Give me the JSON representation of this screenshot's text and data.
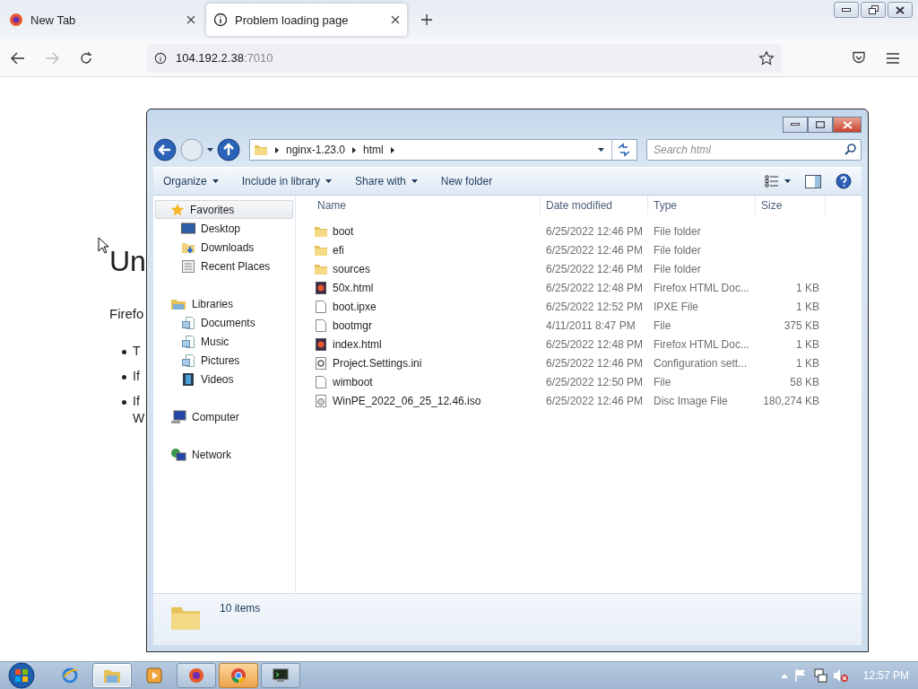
{
  "browser": {
    "tabs": [
      {
        "title": "New Tab",
        "selected": false,
        "kind": "firefox"
      },
      {
        "title": "Problem loading page",
        "selected": true,
        "kind": "info"
      }
    ],
    "address": {
      "host": "104.192.2.38",
      "port": ":7010"
    }
  },
  "page": {
    "heading": "Un",
    "paragraph": "Firefo",
    "bullets": [
      {
        "lines": [
          "T"
        ]
      },
      {
        "lines": [
          "If"
        ]
      },
      {
        "lines": [
          "If",
          "W"
        ]
      }
    ]
  },
  "explorer": {
    "breadcrumb": [
      "nginx-1.23.0",
      "html"
    ],
    "search": {
      "placeholder": "Search html"
    },
    "toolbar": [
      {
        "label": "Organize",
        "dropdown": true
      },
      {
        "label": "Include in library",
        "dropdown": true
      },
      {
        "label": "Share with",
        "dropdown": true
      },
      {
        "label": "New folder",
        "dropdown": false
      }
    ],
    "nav": [
      {
        "label": "Favorites",
        "kind": "star",
        "selected": true,
        "children": [
          {
            "label": "Desktop",
            "kind": "desktop",
            "selected": false
          },
          {
            "label": "Downloads",
            "kind": "downloads",
            "selected": false
          },
          {
            "label": "Recent Places",
            "kind": "recent",
            "selected": false
          }
        ]
      },
      {
        "label": "Libraries",
        "kind": "library",
        "selected": false,
        "children": [
          {
            "label": "Documents",
            "kind": "document",
            "selected": false
          },
          {
            "label": "Music",
            "kind": "document",
            "selected": false
          },
          {
            "label": "Pictures",
            "kind": "document",
            "selected": false
          },
          {
            "label": "Videos",
            "kind": "videos",
            "selected": false
          }
        ]
      },
      {
        "label": "Computer",
        "kind": "computer",
        "selected": false
      },
      {
        "label": "Network",
        "kind": "network",
        "selected": false
      }
    ],
    "columns": [
      "Name",
      "Date modified",
      "Type",
      "Size"
    ],
    "files": [
      {
        "name": "boot",
        "date": "6/25/2022 12:46 PM",
        "type": "File folder",
        "kind": "folder"
      },
      {
        "name": "efi",
        "date": "6/25/2022 12:46 PM",
        "type": "File folder",
        "kind": "folder"
      },
      {
        "name": "sources",
        "date": "6/25/2022 12:46 PM",
        "type": "File folder",
        "kind": "folder"
      },
      {
        "name": "50x.html",
        "date": "6/25/2022 12:48 PM",
        "type": "Firefox HTML Doc...",
        "size": "1 KB",
        "kind": "html"
      },
      {
        "name": "boot.ipxe",
        "date": "6/25/2022 12:52 PM",
        "type": "IPXE File",
        "size": "1 KB",
        "kind": "file"
      },
      {
        "name": "bootmgr",
        "date": "4/11/2011 8:47 PM",
        "type": "File",
        "size": "375 KB",
        "kind": "file"
      },
      {
        "name": "index.html",
        "date": "6/25/2022 12:48 PM",
        "type": "Firefox HTML Doc...",
        "size": "1 KB",
        "kind": "html"
      },
      {
        "name": "Project.Settings.ini",
        "date": "6/25/2022 12:46 PM",
        "type": "Configuration sett...",
        "size": "1 KB",
        "kind": "settings"
      },
      {
        "name": "wimboot",
        "date": "6/25/2022 12:50 PM",
        "type": "File",
        "size": "58 KB",
        "kind": "file"
      },
      {
        "name": "WinPE_2022_06_25_12.46.iso",
        "date": "6/25/2022 12:46 PM",
        "type": "Disc Image File",
        "size": "180,274 KB",
        "kind": "disc"
      }
    ],
    "status": "10 items"
  },
  "taskbar": {
    "apps": [
      {
        "kind": "ie",
        "open": false,
        "selected": false,
        "flashing": false
      },
      {
        "kind": "explorer",
        "open": true,
        "selected": true,
        "flashing": false
      },
      {
        "kind": "media",
        "open": false,
        "selected": false,
        "flashing": false
      },
      {
        "kind": "firefox",
        "open": true,
        "selected": false,
        "flashing": false
      },
      {
        "kind": "chrome",
        "open": true,
        "selected": false,
        "flashing": true
      },
      {
        "kind": "terminal",
        "open": true,
        "selected": false,
        "flashing": false
      }
    ],
    "clock": "12:57 PM"
  }
}
